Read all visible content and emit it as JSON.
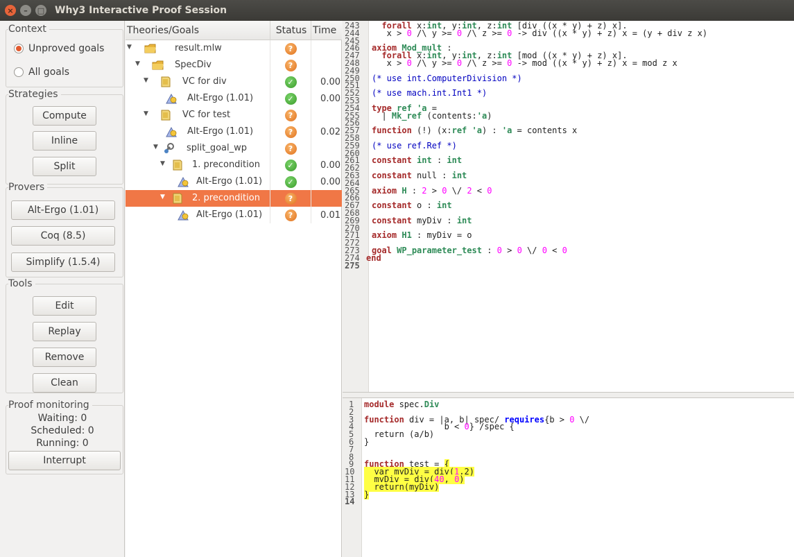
{
  "window": {
    "title": "Why3 Interactive Proof Session"
  },
  "left": {
    "context_label": "Context",
    "radio_unproved": "Unproved goals",
    "radio_all": "All goals",
    "strategies_label": "Strategies",
    "compute": "Compute",
    "inline": "Inline",
    "split": "Split",
    "provers_label": "Provers",
    "prover_altergo": "Alt-Ergo (1.01)",
    "prover_coq": "Coq (8.5)",
    "prover_simplify": "Simplify (1.5.4)",
    "tools_label": "Tools",
    "edit": "Edit",
    "replay": "Replay",
    "remove": "Remove",
    "clean": "Clean",
    "monitor_label": "Proof monitoring",
    "waiting": "Waiting: 0",
    "scheduled": "Scheduled: 0",
    "running": "Running: 0",
    "interrupt": "Interrupt"
  },
  "tree": {
    "col_goals": "Theories/Goals",
    "col_status": "Status",
    "col_time": "Time",
    "rows": [
      {
        "label": "result.mlw",
        "status": "unknown",
        "time": ""
      },
      {
        "label": "SpecDiv",
        "status": "unknown",
        "time": ""
      },
      {
        "label": "VC for div",
        "status": "proved",
        "time": "0.00"
      },
      {
        "label": "Alt-Ergo (1.01)",
        "status": "proved",
        "time": "0.00"
      },
      {
        "label": "VC for test",
        "status": "unknown",
        "time": ""
      },
      {
        "label": "Alt-Ergo (1.01)",
        "status": "unknown",
        "time": "0.02"
      },
      {
        "label": "split_goal_wp",
        "status": "unknown",
        "time": ""
      },
      {
        "label": "1. precondition",
        "status": "proved",
        "time": "0.00"
      },
      {
        "label": "Alt-Ergo (1.01)",
        "status": "proved",
        "time": "0.00"
      },
      {
        "label": "2. precondition",
        "status": "unknown",
        "time": ""
      },
      {
        "label": "Alt-Ergo (1.01)",
        "status": "unknown",
        "time": "0.01"
      }
    ]
  },
  "task_view": {
    "line_numbers": [
      "243",
      "244",
      "245",
      "246",
      "247",
      "248",
      "249",
      "250",
      "251",
      "252",
      "253",
      "254",
      "255",
      "256",
      "257",
      "258",
      "259",
      "260",
      "261",
      "262",
      "263",
      "264",
      "265",
      "266",
      "267",
      "268",
      "269",
      "270",
      "271",
      "272",
      "273",
      "274",
      "275"
    ],
    "lines": [
      "    forall x:int, y:int, z:int [div ((x * y) + z) x].",
      "     x > 0 /\\ y >= 0 /\\ z >= 0 -> div ((x * y) + z) x = (y + div z x)",
      "",
      "  axiom Mod_mult :",
      "    forall x:int, y:int, z:int [mod ((x * y) + z) x].",
      "     x > 0 /\\ y >= 0 /\\ z >= 0 -> mod ((x * y) + z) x = mod z x",
      "",
      "  (* use int.ComputerDivision *)",
      "",
      "  (* use mach.int.Int1 *)",
      "",
      "  type ref 'a =",
      "    | Mk_ref (contents:'a)",
      "",
      "  function (!) (x:ref 'a) : 'a = contents x",
      "",
      "  (* use ref.Ref *)",
      "",
      "  constant int : int",
      "",
      "  constant null : int",
      "",
      "  axiom H : 2 > 0 \\/ 2 < 0",
      "",
      "  constant o : int",
      "",
      "  constant myDiv : int",
      "",
      "  axiom H1 : myDiv = o",
      "",
      "  goal WP_parameter_test : 0 > 0 \\/ 0 < 0",
      "end",
      ""
    ]
  },
  "source_view": {
    "line_numbers": [
      "1",
      "2",
      "3",
      "4",
      "5",
      "6",
      "7",
      "8",
      "9",
      "10",
      "11",
      "12",
      "13",
      "14"
    ],
    "lines": [
      "module spec.Div",
      "",
      "function div = |a, b| spec/ requires{b > 0 \\/",
      "                b < 0} /spec {",
      "  return (a/b)",
      "}",
      "",
      "",
      "function test = {",
      "  var myDiv = div(1,2)",
      "  myDiv = div(40, 0)",
      "  return(myDiv)",
      "}",
      ""
    ]
  }
}
